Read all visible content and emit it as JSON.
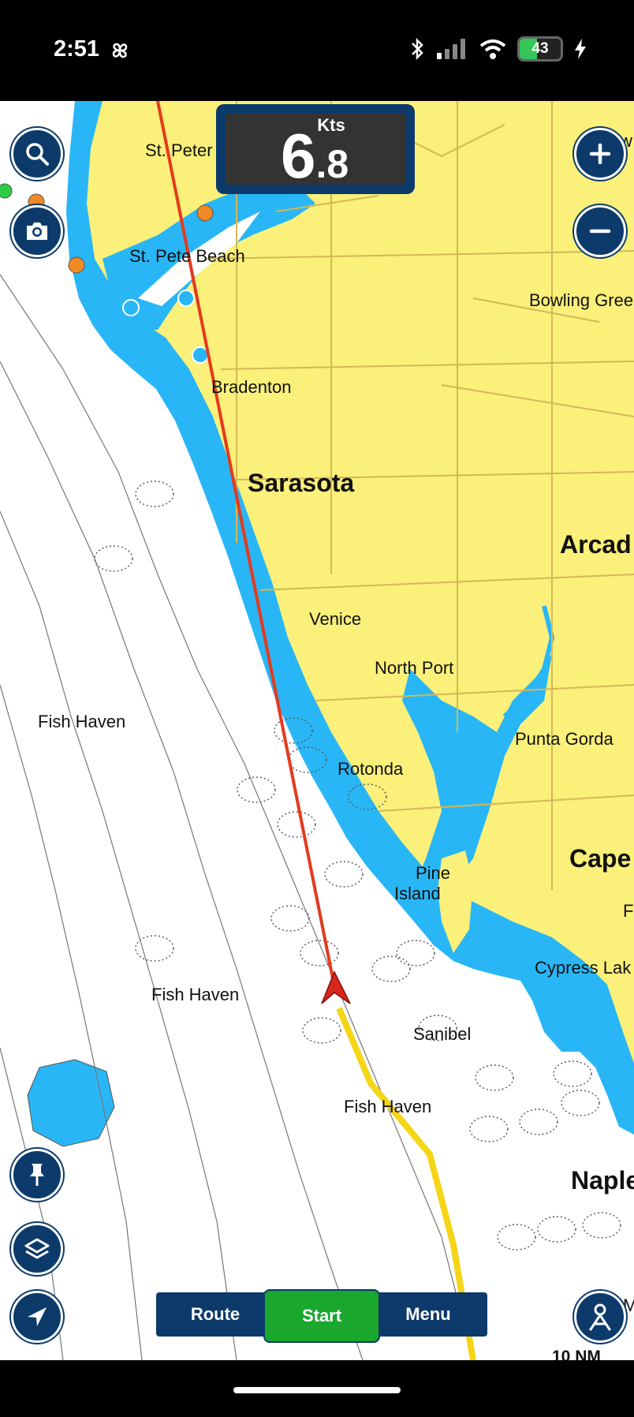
{
  "status_bar": {
    "time": "2:51",
    "battery_percent": "43",
    "icons": [
      "pinwheel-icon",
      "bluetooth-icon",
      "signal-icon",
      "wifi-icon",
      "battery-icon",
      "charging-bolt-icon"
    ]
  },
  "speed": {
    "unit": "Kts",
    "whole": "6",
    "decimal": ".8"
  },
  "places": [
    {
      "id": "st-pete",
      "label": "St. Peter"
    },
    {
      "id": "st-pete-beach",
      "label": "St. Pete Beach"
    },
    {
      "id": "bradenton",
      "label": "Bradenton"
    },
    {
      "id": "sarasota",
      "label": "Sarasota"
    },
    {
      "id": "venice",
      "label": "Venice"
    },
    {
      "id": "north-port",
      "label": "North Port"
    },
    {
      "id": "punta-gorda",
      "label": "Punta Gorda"
    },
    {
      "id": "rotonda",
      "label": "Rotonda"
    },
    {
      "id": "pine",
      "label": "Pine"
    },
    {
      "id": "island",
      "label": "Island"
    },
    {
      "id": "cypress-lake",
      "label": "Cypress Lak"
    },
    {
      "id": "sanibel",
      "label": "Sanibel"
    },
    {
      "id": "fish-haven-1",
      "label": "Fish Haven"
    },
    {
      "id": "fish-haven-2",
      "label": "Fish Haven"
    },
    {
      "id": "fish-haven-3",
      "label": "Fish Haven"
    },
    {
      "id": "bowling-green",
      "label": "Bowling Gree"
    },
    {
      "id": "arcadia",
      "label": "Arcad"
    },
    {
      "id": "cape",
      "label": "Cape"
    },
    {
      "id": "naples",
      "label": "Naple"
    },
    {
      "id": "clipped-w",
      "label": "w"
    },
    {
      "id": "clipped-f",
      "label": "F"
    },
    {
      "id": "clipped-ma",
      "label": "Ma"
    }
  ],
  "buttons": {
    "route": "Route",
    "start": "Start",
    "menu": "Menu"
  },
  "scale": {
    "label": "10 NM"
  },
  "colors": {
    "land": "#faf07a",
    "water_shallow": "#29b6f6",
    "water_deep": "#ffffff",
    "ui_navy": "#0c3a6a",
    "start_green": "#19a72e",
    "course_line": "#e53a1e",
    "track_line": "#f5d515"
  }
}
